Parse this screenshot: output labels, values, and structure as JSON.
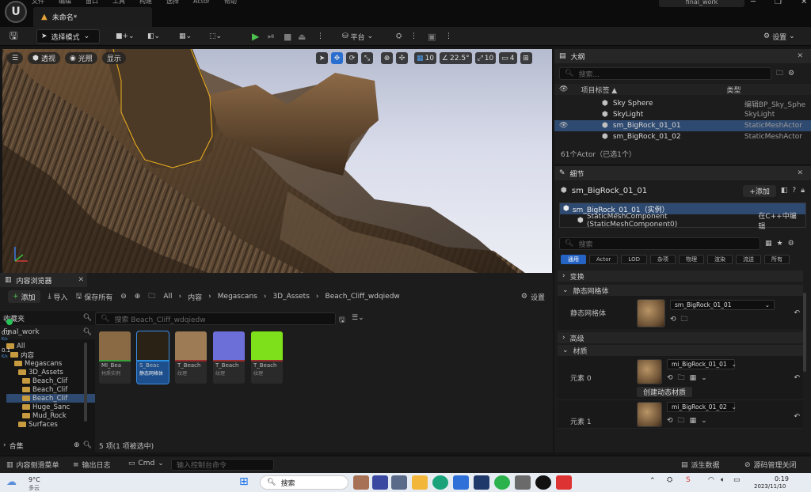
{
  "menu": [
    "文件",
    "编辑",
    "窗口",
    "工具",
    "构建",
    "选择",
    "Actor",
    "帮助"
  ],
  "document_tab": "未命名*",
  "project_name": "final_work",
  "toolbar": {
    "mode_label": "选择模式",
    "platform_label": "平台",
    "settings_label": "设置"
  },
  "viewport": {
    "view_mode": "透视",
    "lit_mode": "光照",
    "show_label": "显示",
    "grid_snap": "10",
    "rotation_snap": "22.5°",
    "scale_snap": "10",
    "camera_speed": "4"
  },
  "outliner": {
    "tab": "大纲",
    "search_placeholder": "搜索...",
    "col_label": "项目标签 ▲",
    "col_type": "类型",
    "rows": [
      {
        "name": "Sky Sphere",
        "type": "编辑BP_Sky_Sphe",
        "type_link": true
      },
      {
        "name": "SkyLight",
        "type": "SkyLight",
        "type_link": false
      },
      {
        "name": "sm_BigRock_01_01",
        "type": "StaticMeshActor",
        "type_link": false,
        "selected": true
      },
      {
        "name": "sm_BigRock_01_02",
        "type": "StaticMeshActor",
        "type_link": false
      }
    ],
    "footer": "61个Actor（已选1个）"
  },
  "details": {
    "tab": "细节",
    "object_name": "sm_BigRock_01_01",
    "add_label": "+添加",
    "instance_label": "sm_BigRock_01_01（实例）",
    "component_label": "StaticMeshComponent (StaticMeshComponent0)",
    "component_edit": "在C++中编辑",
    "search_placeholder": "搜索",
    "filters": [
      "通用",
      "Actor",
      "LOD",
      "杂项",
      "物理",
      "渲染",
      "流送",
      "所有"
    ],
    "sections": {
      "transform": "变换",
      "static_mesh": "静态网格体",
      "advanced": "高级",
      "materials": "材质"
    },
    "static_mesh_label": "静态网格体",
    "static_mesh_value": "sm_BigRock_01_01",
    "element0_label": "元素 0",
    "element0_value": "mi_BigRock_01_01",
    "create_dynamic_material": "创建动态材质",
    "element1_label": "元素 1",
    "element1_value": "mi_BigRock_01_02"
  },
  "content_browser": {
    "tab": "内容浏览器",
    "add_label": "添加",
    "import_label": "导入",
    "save_all_label": "保存所有",
    "settings_label": "设置",
    "breadcrumb": [
      "All",
      "内容",
      "Megascans",
      "3D_Assets",
      "Beach_Cliff_wdqiedw"
    ],
    "favorites_label": "收藏夹",
    "project_label": "final_work",
    "search_placeholder": "搜索 Beach_Cliff_wdqiedw",
    "tree": [
      {
        "label": "All",
        "indent": 0
      },
      {
        "label": "内容",
        "indent": 1
      },
      {
        "label": "Megascans",
        "indent": 2
      },
      {
        "label": "3D_Assets",
        "indent": 3
      },
      {
        "label": "Beach_Clif",
        "indent": 4
      },
      {
        "label": "Beach_Clif",
        "indent": 4
      },
      {
        "label": "Beach_Clif",
        "indent": 4,
        "selected": true
      },
      {
        "label": "Huge_Sanc",
        "indent": 4
      },
      {
        "label": "Mud_Rock",
        "indent": 4
      },
      {
        "label": "Surfaces",
        "indent": 3
      }
    ],
    "collections_label": "合集",
    "assets": [
      {
        "name": "MI_Bea",
        "type": "材质实例",
        "color": "#8a6a45",
        "bar": "#3aa13a"
      },
      {
        "name": "S_Beac",
        "type": "静态网格体",
        "color": "#2b2216",
        "bar": "#2a8fe0",
        "selected": true
      },
      {
        "name": "T_Beach",
        "type": "纹理",
        "color": "#9d7b55",
        "bar": "#9b2c2c"
      },
      {
        "name": "T_Beach",
        "type": "纹理",
        "color": "#6c6fd8",
        "bar": "#9b2c2c"
      },
      {
        "name": "T_Beach",
        "type": "纹理",
        "color": "#7ee01a",
        "bar": "#9b2c2c"
      }
    ],
    "status": "5 项(1 项被选中)",
    "side_stats": [
      {
        "value": "0.2",
        "unit": "K/s"
      },
      {
        "value": "0.1",
        "unit": "K/s"
      }
    ]
  },
  "statusbar": {
    "drawer": "内容侧滑菜单",
    "output_log": "输出日志",
    "cmd": "Cmd",
    "cmd_placeholder": "输入控制台命令",
    "derived_data": "派生数据",
    "source_control": "源码管理关闭"
  },
  "taskbar": {
    "weather_temp": "9°C",
    "weather_desc": "多云",
    "search": "搜索",
    "time": "0:19",
    "date": "2023/11/10"
  }
}
